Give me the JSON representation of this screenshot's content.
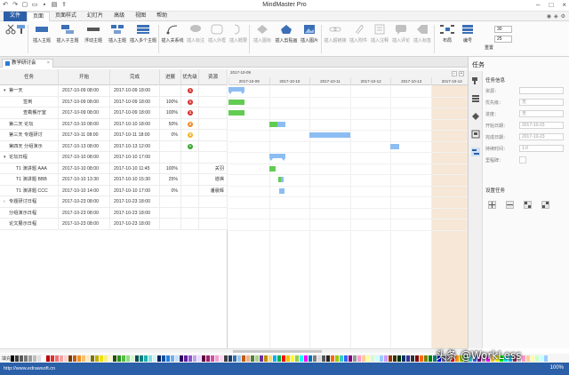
{
  "app": {
    "title": "MindMaster Pro"
  },
  "menu": {
    "file": "文件",
    "tabs": [
      "页面",
      "页面样式",
      "幻灯片",
      "高级",
      "视图",
      "帮助"
    ],
    "active_index": 0
  },
  "ribbon": {
    "buttons": [
      "插入主题",
      "插入子主题",
      "浮动主题",
      "插入主题",
      "插入多个主题",
      "插入关系线",
      "插入标注",
      "插入外框",
      "插入概要",
      "插入图标",
      "插入剪贴画",
      "插入图片",
      "插入超链接",
      "插入附件",
      "插入注释",
      "插入评论",
      "插入标签",
      "布局",
      "编号",
      "重置"
    ],
    "font_size_1": "30",
    "font_size_2": "25"
  },
  "doc_tab": {
    "name": "教学研讨会"
  },
  "table": {
    "headers": [
      "任务",
      "开始",
      "完成",
      "进展",
      "优先级",
      "资源"
    ],
    "rows": [
      {
        "task": "第一天",
        "start": "2017-10-09 08:00",
        "end": "2017-10-09 18:00",
        "progress": "",
        "priority": "1",
        "priority_color": "#d9302b",
        "resource": "",
        "level": 0,
        "caret": "▾"
      },
      {
        "task": "签到",
        "start": "2017-10-09 08:00",
        "end": "2017-10-09 18:00",
        "progress": "100%",
        "priority": "1",
        "priority_color": "#d9302b",
        "resource": "",
        "level": 2,
        "caret": ""
      },
      {
        "task": "查勘餐厅室",
        "start": "2017-10-09 08:00",
        "end": "2017-10-09 18:00",
        "progress": "100%",
        "priority": "1",
        "priority_color": "#d9302b",
        "resource": "",
        "level": 2,
        "caret": ""
      },
      {
        "task": "第二天 论坛",
        "start": "2017-10-10 08:00",
        "end": "2017-10-10 18:00",
        "progress": "50%",
        "priority": "2",
        "priority_color": "#f08a24",
        "resource": "",
        "level": 0,
        "caret": ""
      },
      {
        "task": "第三天 专题研讨",
        "start": "2017-10-11 08:00",
        "end": "2017-10-11 18:00",
        "progress": "0%",
        "priority": "3",
        "priority_color": "#f5b324",
        "resource": "",
        "level": 0,
        "caret": ""
      },
      {
        "task": "第四天 分组演示",
        "start": "2017-10-13 08:00",
        "end": "2017-10-13 12:00",
        "progress": "",
        "priority": "+",
        "priority_color": "#3ba832",
        "resource": "",
        "level": 0,
        "caret": ""
      },
      {
        "task": "论坛日程",
        "start": "2017-10-10 08:00",
        "end": "2017-10-10 17:00",
        "progress": "",
        "priority": "",
        "priority_color": "",
        "resource": "",
        "level": 0,
        "caret": "▾"
      },
      {
        "task": "T1 演讲题 AAA",
        "start": "2017-10-10 08:00",
        "end": "2017-10-10 11:45",
        "progress": "100%",
        "priority": "",
        "priority_color": "",
        "resource": "关羽",
        "level": 1,
        "caret": ""
      },
      {
        "task": "T1 演讲题 BBB",
        "start": "2017-10-10 13:30",
        "end": "2017-10-10 15:30",
        "progress": "25%",
        "priority": "",
        "priority_color": "",
        "resource": "道祺",
        "level": 1,
        "caret": ""
      },
      {
        "task": "T1 演讲题 CCC",
        "start": "2017-10-10 14:00",
        "end": "2017-10-10 17:00",
        "progress": "0%",
        "priority": "",
        "priority_color": "",
        "resource": "潘晨辉",
        "level": 1,
        "caret": ""
      },
      {
        "task": "专题研讨日程",
        "start": "2017-10-23 08:00",
        "end": "2017-10-23 18:00",
        "progress": "",
        "priority": "",
        "priority_color": "",
        "resource": "",
        "level": 0,
        "caret": "›"
      },
      {
        "task": "分组演示日程",
        "start": "2017-10-23 08:00",
        "end": "2017-10-23 18:00",
        "progress": "",
        "priority": "",
        "priority_color": "",
        "resource": "",
        "level": 0,
        "caret": ""
      },
      {
        "task": "论文展示日程",
        "start": "2017-10-23 08:00",
        "end": "2017-10-23 18:00",
        "progress": "",
        "priority": "",
        "priority_color": "",
        "resource": "",
        "level": 0,
        "caret": ""
      }
    ]
  },
  "gantt": {
    "month_label": "2017-10-09",
    "days": [
      "2017-10-09",
      "2017-10-10",
      "2017-10-11",
      "2017-10-12",
      "2017-10-13",
      "2017-10-14"
    ],
    "bars": [
      {
        "row": 0,
        "start": 0.0,
        "end": 0.4,
        "type": "summary"
      },
      {
        "row": 1,
        "start": 0.0,
        "end": 0.4,
        "type": "green"
      },
      {
        "row": 2,
        "start": 0.0,
        "end": 0.4,
        "type": "green"
      },
      {
        "row": 3,
        "start": 1.0,
        "end": 1.2,
        "type": "green"
      },
      {
        "row": 3,
        "start": 1.2,
        "end": 1.4,
        "type": "blue"
      },
      {
        "row": 4,
        "start": 2.0,
        "end": 2.4,
        "type": "blue"
      },
      {
        "row": 4,
        "start": 2.4,
        "end": 3.0,
        "type": "blue"
      },
      {
        "row": 5,
        "start": 4.0,
        "end": 4.2,
        "type": "blue"
      },
      {
        "row": 6,
        "start": 1.0,
        "end": 1.4,
        "type": "summary"
      },
      {
        "row": 7,
        "start": 1.0,
        "end": 1.16,
        "type": "green"
      },
      {
        "row": 8,
        "start": 1.23,
        "end": 1.3,
        "type": "green"
      },
      {
        "row": 8,
        "start": 1.3,
        "end": 1.35,
        "type": "blue"
      },
      {
        "row": 9,
        "start": 1.26,
        "end": 1.39,
        "type": "blue"
      }
    ]
  },
  "panel": {
    "title": "任务",
    "section1": "任务信息",
    "fields": [
      {
        "label": "资源：",
        "value": ""
      },
      {
        "label": "优先级：",
        "value": "无"
      },
      {
        "label": "进度：",
        "value": "无"
      },
      {
        "label": "开始日期：",
        "value": "2017-10-23"
      },
      {
        "label": "完成日期：",
        "value": "2017-10-23"
      },
      {
        "label": "持续时间：",
        "value": "1.0"
      },
      {
        "label": "里程碑：",
        "value": ""
      }
    ],
    "side_extra_1": "100",
    "side_extra_2": "100",
    "section2": "设置任务"
  },
  "palette": {
    "label": "填充",
    "colors": [
      "#000000",
      "#3a3a3a",
      "#5a5a5a",
      "#7a7a7a",
      "#9a9a9a",
      "#bdbdbd",
      "#dedede",
      "#ffffff",
      "#c00000",
      "#e03030",
      "#f07070",
      "#f5a0a0",
      "#ffd0d0",
      "#7a3a00",
      "#c06010",
      "#f09020",
      "#f5c070",
      "#ffe8c0",
      "#807000",
      "#c0b000",
      "#f0e000",
      "#f8f080",
      "#fff8c0",
      "#205000",
      "#309020",
      "#50c040",
      "#90e080",
      "#d0f8c8",
      "#005050",
      "#008080",
      "#20b0b0",
      "#80e0e0",
      "#c8f8f8",
      "#002060",
      "#1050a0",
      "#2080e0",
      "#70b0f0",
      "#c0e0ff",
      "#300060",
      "#6020a0",
      "#9050d0",
      "#c0a0f0",
      "#e8d8ff",
      "#600040",
      "#a02070",
      "#d050a0",
      "#f0a0d0",
      "#ffd8f0",
      "#404040",
      "#1f3864",
      "#2e75b6",
      "#9dc3e6",
      "#c55a11",
      "#f4b183",
      "#548235",
      "#a9d18e",
      "#7030a0",
      "#bf9000",
      "#ffd966",
      "#00b0f0",
      "#00b050",
      "#ff0000",
      "#ffc000",
      "#ffff00",
      "#92d050",
      "#00ffff",
      "#ff00ff",
      "#0070c0",
      "#7f7f7f",
      "#d9d9d9",
      "#595959",
      "#262626",
      "#ff6600",
      "#99cc00",
      "#33cccc",
      "#3366ff",
      "#800080",
      "#969696",
      "#ff99cc",
      "#ffcc99",
      "#ffff99",
      "#ccffcc",
      "#ccffff",
      "#99ccff",
      "#cc99ff",
      "#993300",
      "#333300",
      "#003300",
      "#003366",
      "#333399",
      "#333333",
      "#800000",
      "#ff6600",
      "#808000",
      "#008000",
      "#008080",
      "#0000ff",
      "#666699",
      "#808080",
      "#ff0000",
      "#ff9900",
      "#99cc00",
      "#339966",
      "#33cccc",
      "#3366ff",
      "#800080",
      "#999999",
      "#ff00ff",
      "#ffcc00",
      "#ffff00",
      "#00ff00",
      "#00ffff",
      "#00ccff",
      "#993366",
      "#c0c0c0",
      "#ff99cc",
      "#ffcc99",
      "#ffff99",
      "#ccffcc",
      "#ccffff",
      "#99ccff"
    ]
  },
  "status": {
    "url": "http://www.edrawsoft.cn",
    "zoom": "100%"
  },
  "watermark": "头条 @WorkLess"
}
